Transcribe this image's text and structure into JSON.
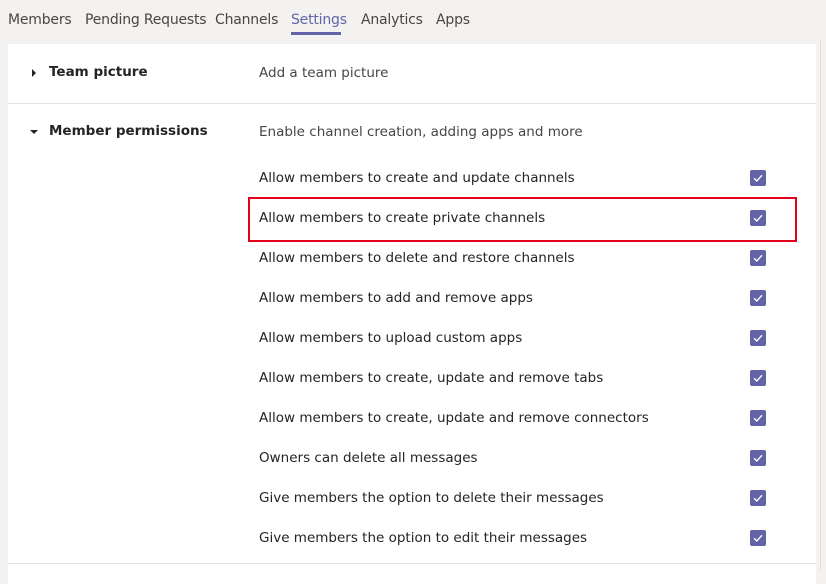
{
  "tabs": [
    {
      "label": "Members"
    },
    {
      "label": "Pending Requests"
    },
    {
      "label": "Channels"
    },
    {
      "label": "Settings"
    },
    {
      "label": "Analytics"
    },
    {
      "label": "Apps"
    }
  ],
  "active_tab": "Settings",
  "sections": {
    "team_picture": {
      "title": "Team picture",
      "description": "Add a team picture"
    },
    "member_permissions": {
      "title": "Member permissions",
      "description": "Enable channel creation, adding apps and more"
    }
  },
  "permissions": [
    {
      "label": "Allow members to create and update channels",
      "checked": true
    },
    {
      "label": "Allow members to create private channels",
      "checked": true
    },
    {
      "label": "Allow members to delete and restore channels",
      "checked": true
    },
    {
      "label": "Allow members to add and remove apps",
      "checked": true
    },
    {
      "label": "Allow members to upload custom apps",
      "checked": true
    },
    {
      "label": "Allow members to create, update and remove tabs",
      "checked": true
    },
    {
      "label": "Allow members to create, update and remove connectors",
      "checked": true
    },
    {
      "label": "Owners can delete all messages",
      "checked": true
    },
    {
      "label": "Give members the option to delete their messages",
      "checked": true
    },
    {
      "label": "Give members the option to edit their messages",
      "checked": true
    }
  ],
  "colors": {
    "accent": "#6264a7",
    "highlight": "#e2001a"
  }
}
